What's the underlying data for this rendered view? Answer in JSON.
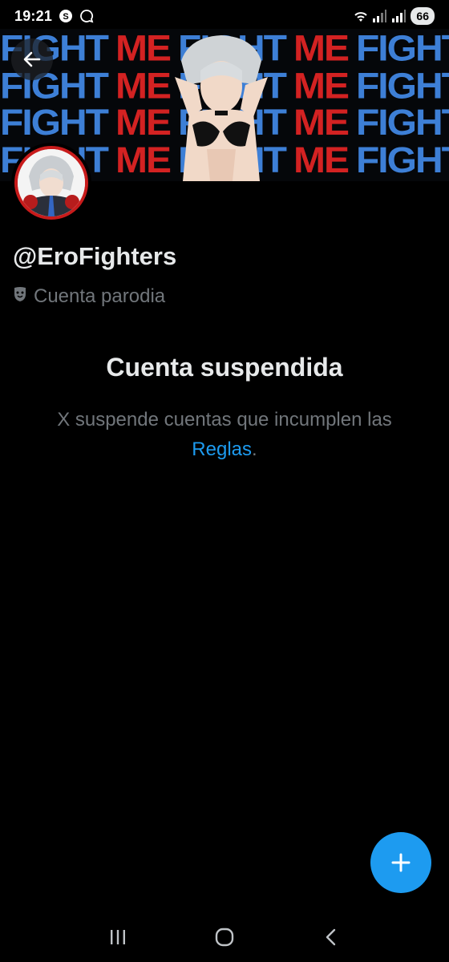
{
  "status_bar": {
    "time": "19:21",
    "battery": "66",
    "icons": [
      "shazam-icon",
      "chat-bubble-icon",
      "wifi-icon",
      "signal-icon",
      "signal-icon"
    ]
  },
  "banner": {
    "words": [
      "FIGHT",
      "ME",
      "FIGHT",
      "ME",
      "FIGHT",
      "ME"
    ],
    "colors": {
      "fight": "#3d7fd6",
      "me": "#d32222"
    }
  },
  "profile": {
    "handle": "@EroFighters",
    "parody_label": "Cuenta parodia",
    "avatar_ring_color": "#c81b1b"
  },
  "suspended": {
    "title": "Cuenta suspendida",
    "message": "X suspende cuentas que incumplen las",
    "link": "Reglas",
    "suffix": "."
  },
  "fab": {
    "icon": "plus-icon"
  },
  "colors": {
    "accent": "#1d9bf0",
    "muted": "#71767b",
    "text": "#e7e9ea"
  }
}
